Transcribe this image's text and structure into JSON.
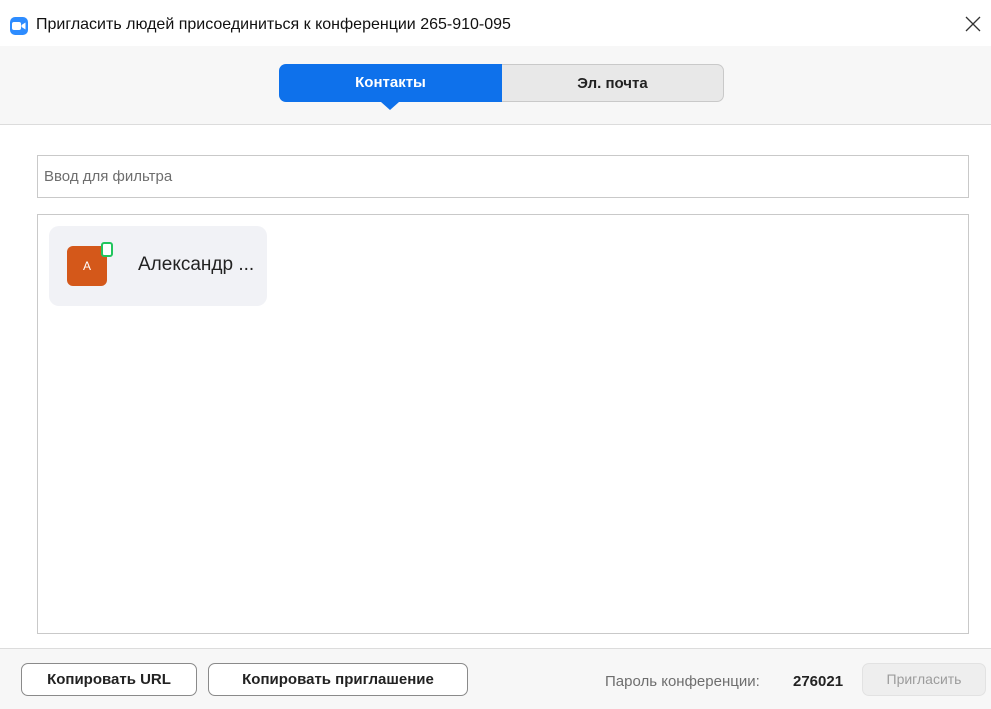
{
  "window": {
    "title": "Пригласить людей присоединиться к конференции 265-910-095",
    "app_icon": "video-camera-icon",
    "close_icon": "close-icon"
  },
  "tabs": [
    {
      "label": "Контакты",
      "active": true
    },
    {
      "label": "Эл. почта",
      "active": false
    }
  ],
  "filter": {
    "placeholder": "Ввод для фильтра",
    "value": ""
  },
  "contacts": [
    {
      "initial": "А",
      "name": "Александр ...",
      "status": "online",
      "avatar_color": "#d4581a"
    }
  ],
  "footer": {
    "copy_url_label": "Копировать URL",
    "copy_invite_label": "Копировать приглашение",
    "password_label": "Пароль конференции:",
    "password_value": "276021",
    "invite_label": "Пригласить",
    "invite_enabled": false
  },
  "colors": {
    "accent": "#0e71eb",
    "presence_online": "#22c55e"
  }
}
